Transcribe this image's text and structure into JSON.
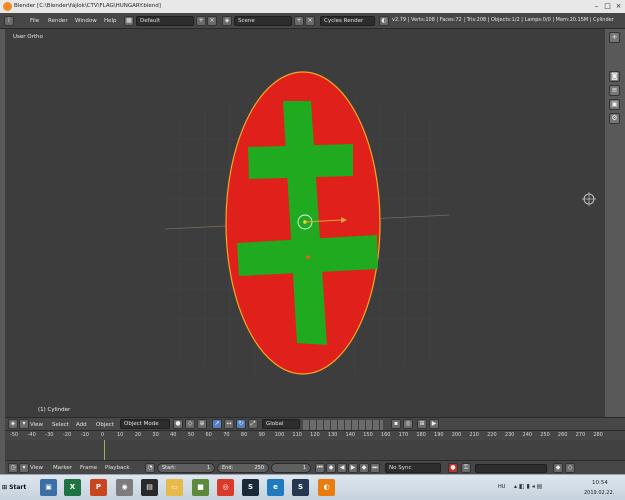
{
  "window": {
    "title": "Blender [C:\\Blender\\fájlok\\CTV\\FLAG\\HUNGARY.blend]",
    "minimize_glyph": "–",
    "maximize_glyph": "□",
    "close_glyph": "×"
  },
  "menubar": {
    "items": [
      "File",
      "Render",
      "Window",
      "Help"
    ],
    "layout_value": "Default",
    "scene_value": "Scene",
    "engine_value": "Cycles Render",
    "stats": "v2.79 | Verts:108 | Faces:72 | Tris:208 | Objects:1/2 | Lamps:0/0 | Mem:20.15M | Cylinder"
  },
  "viewport": {
    "view_label": "User Ortho",
    "object_label": "(1) Cylinder"
  },
  "viewport_header": {
    "items": [
      "View",
      "Select",
      "Add",
      "Object"
    ],
    "mode_value": "Object Mode",
    "orientation_value": "Global"
  },
  "timeline": {
    "ticks": [
      "-50",
      "-40",
      "-30",
      "-20",
      "-10",
      "0",
      "10",
      "20",
      "30",
      "40",
      "50",
      "60",
      "70",
      "80",
      "90",
      "100",
      "110",
      "120",
      "130",
      "140",
      "150",
      "160",
      "170",
      "180",
      "190",
      "200",
      "210",
      "220",
      "230",
      "240",
      "250",
      "260",
      "270",
      "280"
    ],
    "current_frame": 1
  },
  "timeline_header": {
    "items": [
      "View",
      "Marker",
      "Frame",
      "Playback"
    ],
    "start_label": "Start:",
    "start_value": "1",
    "end_label": "End:",
    "end_value": "250",
    "current_value": "1",
    "sync_value": "No Sync"
  },
  "taskbar": {
    "start_label": "Start",
    "apps": [
      {
        "name": "network-icon",
        "color": "#3a6ea5",
        "glyph": "▣"
      },
      {
        "name": "excel-icon",
        "color": "#1f7244",
        "glyph": "X"
      },
      {
        "name": "powerpoint-icon",
        "color": "#c8461f",
        "glyph": "P"
      },
      {
        "name": "cd-icon",
        "color": "#7c7c7c",
        "glyph": "◉"
      },
      {
        "name": "media-icon",
        "color": "#2a2a2a",
        "glyph": "▤"
      },
      {
        "name": "folder-icon",
        "color": "#e6b94a",
        "glyph": "▭"
      },
      {
        "name": "minecraft-icon",
        "color": "#5b8a3a",
        "glyph": "■"
      },
      {
        "name": "chrome-icon",
        "color": "#d93a2c",
        "glyph": "◎"
      },
      {
        "name": "steam-icon",
        "color": "#1b2838",
        "glyph": "S"
      },
      {
        "name": "edge-icon",
        "color": "#1f7abf",
        "glyph": "e"
      },
      {
        "name": "steam-icon-2",
        "color": "#26374f",
        "glyph": "S"
      },
      {
        "name": "blender-icon",
        "color": "#e87d0d",
        "glyph": "◐"
      }
    ],
    "lang": "HU",
    "time": "10:54",
    "date": "2019.02.22."
  },
  "colors": {
    "flag_red": "#e0201a",
    "flag_green": "#1faa1f",
    "selection_outline": "#f5a623",
    "viewport_bg": "#3d3d3d"
  }
}
